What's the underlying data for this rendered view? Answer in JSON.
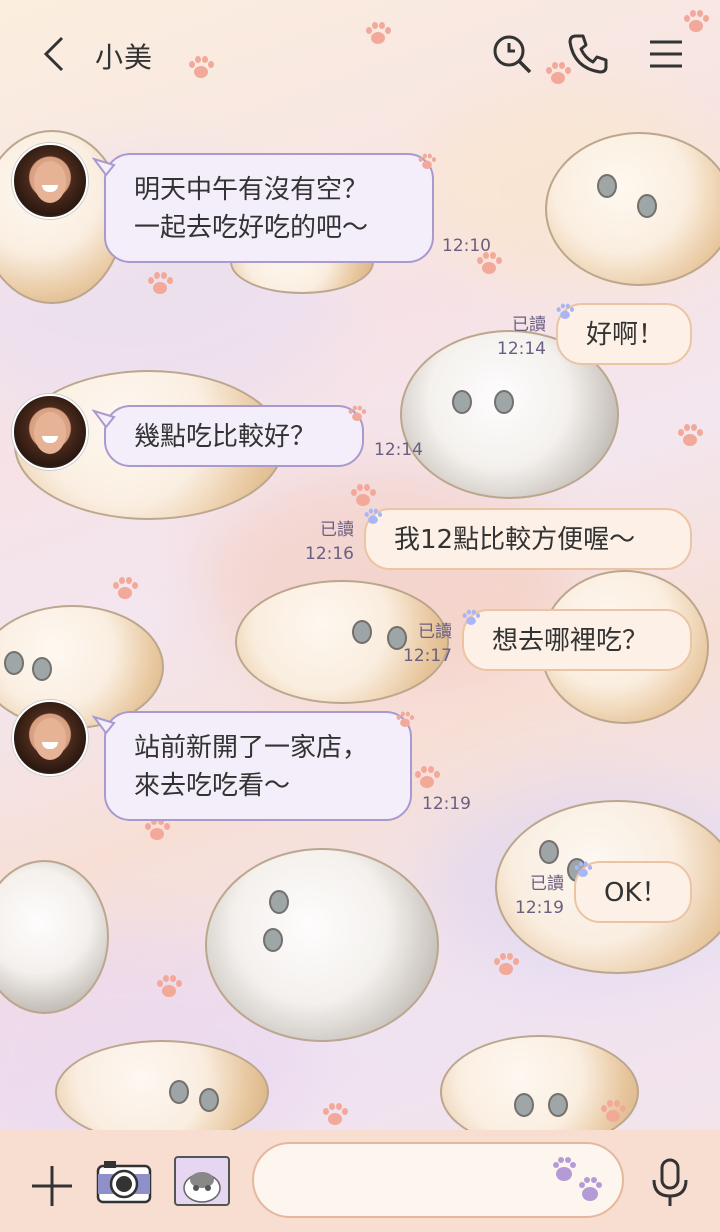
{
  "header": {
    "title": "小美",
    "back_icon": "chevron-left-icon",
    "search_icon": "search-icon",
    "call_icon": "phone-icon",
    "menu_icon": "menu-icon"
  },
  "messages": [
    {
      "side": "in",
      "text": "明天中午有沒有空？\n一起去吃好吃的吧～",
      "time": "12:10"
    },
    {
      "side": "out",
      "text": "好啊！",
      "read": "已讀",
      "time": "12:14"
    },
    {
      "side": "in",
      "text": "幾點吃比較好？",
      "time": "12:14"
    },
    {
      "side": "out",
      "text": "我12點比較方便喔～",
      "read": "已讀",
      "time": "12:16"
    },
    {
      "side": "out",
      "text": "想去哪裡吃？",
      "read": "已讀",
      "time": "12:17"
    },
    {
      "side": "in",
      "text": "站前新開了一家店，\n來去吃吃看～",
      "time": "12:19"
    },
    {
      "side": "out",
      "text": "OK！",
      "read": "已讀",
      "time": "12:19"
    }
  ],
  "footer": {
    "input_value": "",
    "plus_icon": "plus-icon",
    "camera_icon": "camera-icon",
    "sticker_icon": "sticker-icon",
    "mic_icon": "microphone-icon"
  },
  "colors": {
    "in_bubble_border": "#a999cf",
    "out_bubble_border": "#ecc4a3",
    "footer_bg": "#f8ddd1"
  }
}
